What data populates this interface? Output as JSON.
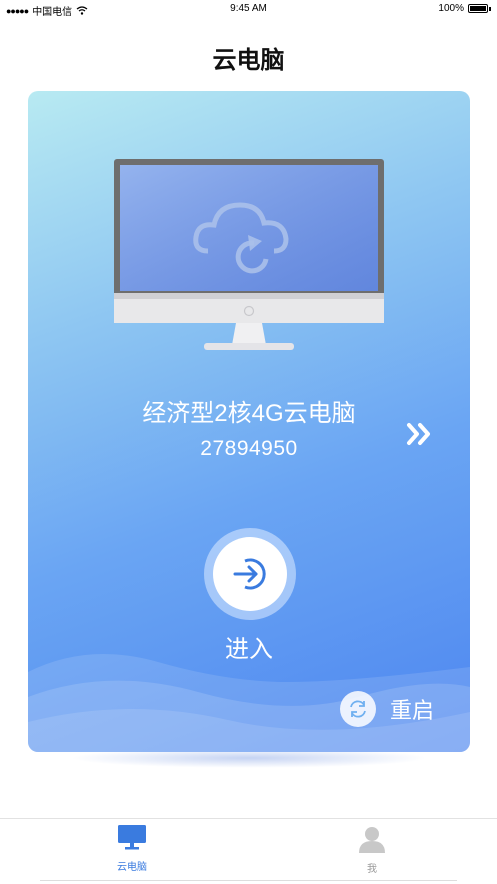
{
  "status_bar": {
    "carrier": "中国电信",
    "time": "9:45 AM",
    "battery": "100%"
  },
  "page_title": "云电脑",
  "computer_card": {
    "name": "经济型2核4G云电脑",
    "id": "27894950",
    "enter_label": "进入",
    "restart_label": "重启",
    "icons": [
      "monitor-cloud-illustration",
      "double-chevron-right-icon",
      "enter-icon",
      "refresh-icon"
    ]
  },
  "tab_bar": {
    "tabs": [
      {
        "label": "云电脑",
        "icon": "monitor-icon",
        "active": true
      },
      {
        "label": "我",
        "icon": "user-icon",
        "active": false
      }
    ]
  },
  "colors": {
    "accent": "#3a7bdf",
    "card_start": "#b8eaf2",
    "card_end": "#4d86f0"
  }
}
